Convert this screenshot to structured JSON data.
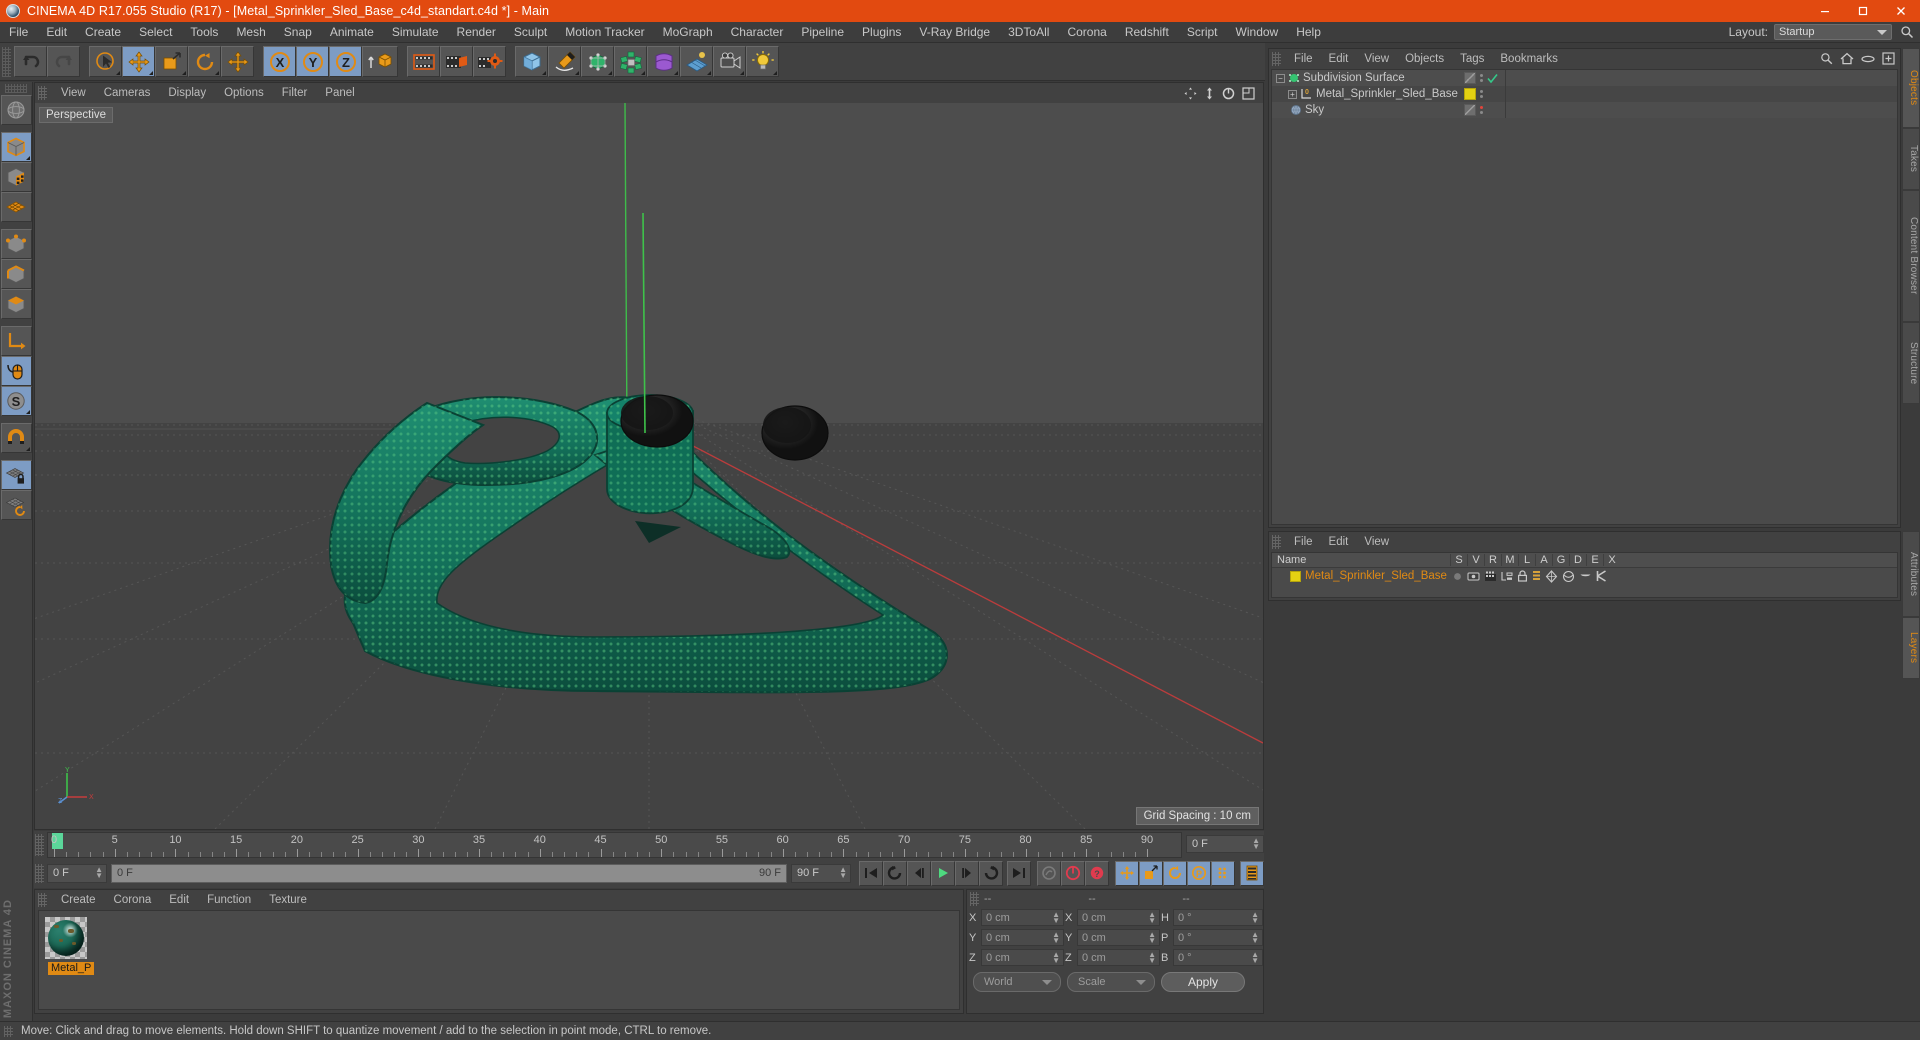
{
  "window": {
    "title": "CINEMA 4D R17.055 Studio (R17) - [Metal_Sprinkler_Sled_Base_c4d_standart.c4d *] - Main",
    "titlebar_color": "#e24a10",
    "minimize": "–",
    "maximize": "❐",
    "close": "✕"
  },
  "menubar": {
    "items": [
      {
        "label": "File"
      },
      {
        "label": "Edit"
      },
      {
        "label": "Create"
      },
      {
        "label": "Select"
      },
      {
        "label": "Tools"
      },
      {
        "label": "Mesh"
      },
      {
        "label": "Snap"
      },
      {
        "label": "Animate"
      },
      {
        "label": "Simulate"
      },
      {
        "label": "Render"
      },
      {
        "label": "Sculpt"
      },
      {
        "label": "Motion Tracker"
      },
      {
        "label": "MoGraph"
      },
      {
        "label": "Character"
      },
      {
        "label": "Pipeline"
      },
      {
        "label": "Plugins"
      },
      {
        "label": "V-Ray Bridge"
      },
      {
        "label": "3DToAll"
      },
      {
        "label": "Corona"
      },
      {
        "label": "Redshift"
      },
      {
        "label": "Script"
      },
      {
        "label": "Window"
      },
      {
        "label": "Help"
      }
    ],
    "layout_label": "Layout:",
    "layout_value": "Startup"
  },
  "toolbar": {
    "buttons": [
      {
        "name": "undo-button",
        "icon": "undo-icon",
        "active": false
      },
      {
        "name": "redo-button",
        "icon": "redo-icon",
        "active": false
      },
      {
        "name": "live-selection-button",
        "icon": "cursor-select-icon",
        "active": false
      },
      {
        "name": "move-tool-button",
        "icon": "move-icon",
        "active": true
      },
      {
        "name": "scale-tool-button",
        "icon": "scale-icon",
        "active": false
      },
      {
        "name": "rotate-tool-button",
        "icon": "rotate-icon",
        "active": false
      },
      {
        "name": "move-axis-button",
        "icon": "move-icon",
        "active": false
      },
      {
        "name": "x-axis-lock-button",
        "icon": "x-axis-icon",
        "active": true
      },
      {
        "name": "y-axis-lock-button",
        "icon": "y-axis-icon",
        "active": true
      },
      {
        "name": "z-axis-lock-button",
        "icon": "z-axis-icon",
        "active": true
      },
      {
        "name": "world-object-coordinates-button",
        "icon": "world-coordinates-icon",
        "active": false
      },
      {
        "name": "render-view-button",
        "icon": "render-frame-icon",
        "active": false
      },
      {
        "name": "render-region-button",
        "icon": "render-region-icon",
        "active": false
      },
      {
        "name": "render-settings-button",
        "icon": "render-settings-icon",
        "active": false
      },
      {
        "name": "add-cube-button",
        "icon": "cube-icon",
        "active": false
      },
      {
        "name": "add-spline-button",
        "icon": "pen-spline-icon",
        "active": false
      },
      {
        "name": "add-generator-button",
        "icon": "subdivision-surface-icon",
        "active": false
      },
      {
        "name": "add-mograph-button",
        "icon": "mograph-cloner-icon",
        "active": false
      },
      {
        "name": "add-deformer-button",
        "icon": "deformer-icon",
        "active": false
      },
      {
        "name": "add-scene-button",
        "icon": "scene-floor-icon",
        "active": false
      },
      {
        "name": "add-camera-button",
        "icon": "camera-icon",
        "active": false
      },
      {
        "name": "add-light-button",
        "icon": "light-bulb-icon",
        "active": false
      }
    ]
  },
  "left_toolbar": {
    "buttons": [
      {
        "name": "use-model-tool-button",
        "icon": "globe-axis-icon",
        "active": false
      },
      {
        "name": "model-mode-button",
        "icon": "model-cube-icon",
        "active": true
      },
      {
        "name": "texture-mode-button",
        "icon": "texture-cube-icon",
        "active": false
      },
      {
        "name": "workplane-mode-button",
        "icon": "workplane-grid-icon",
        "active": false
      },
      {
        "name": "points-mode-button",
        "icon": "points-cube-icon",
        "active": false
      },
      {
        "name": "edges-mode-button",
        "icon": "edges-cube-icon",
        "active": false
      },
      {
        "name": "polygons-mode-button",
        "icon": "polygons-cube-icon",
        "active": false
      },
      {
        "name": "object-axis-mode-button",
        "icon": "axis-corner-icon",
        "active": false
      },
      {
        "name": "viewport-solo-button",
        "icon": "mouse-icon",
        "active": true
      },
      {
        "name": "enable-snap-button",
        "icon": "snap-s-icon",
        "active": true
      },
      {
        "name": "magnet-button",
        "icon": "magnet-icon",
        "active": false
      },
      {
        "name": "workplane-lock-button",
        "icon": "grid-lock-icon",
        "active": true
      },
      {
        "name": "workplane-rotate-button",
        "icon": "grid-rotate-icon",
        "active": false
      }
    ],
    "brand_line1": "MAXON",
    "brand_line2": "CINEMA 4D"
  },
  "viewport": {
    "menu_items": [
      {
        "label": "View"
      },
      {
        "label": "Cameras"
      },
      {
        "label": "Display"
      },
      {
        "label": "Options"
      },
      {
        "label": "Filter"
      },
      {
        "label": "Panel"
      }
    ],
    "label": "Perspective",
    "grid_spacing": "Grid Spacing : 10 cm",
    "nav_icons": [
      "pan-icon",
      "dolly-icon",
      "rotate-view-icon",
      "maximize-view-icon"
    ],
    "axis_labels": {
      "x": "X",
      "y": "Y",
      "z": "Z"
    },
    "model_color": "#157a62",
    "model_dot_color": "#5fcf85",
    "background_top": "#4b4b4b",
    "background_bottom": "#3a3a3a",
    "x_axis_color": "#c83c3c",
    "y_axis_color": "#3ec24a"
  },
  "timeline": {
    "ticks": [
      {
        "label": "0",
        "value": 0
      },
      {
        "label": "5",
        "value": 5
      },
      {
        "label": "10",
        "value": 10
      },
      {
        "label": "15",
        "value": 15
      },
      {
        "label": "20",
        "value": 20
      },
      {
        "label": "25",
        "value": 25
      },
      {
        "label": "30",
        "value": 30
      },
      {
        "label": "35",
        "value": 35
      },
      {
        "label": "40",
        "value": 40
      },
      {
        "label": "45",
        "value": 45
      },
      {
        "label": "50",
        "value": 50
      },
      {
        "label": "55",
        "value": 55
      },
      {
        "label": "60",
        "value": 60
      },
      {
        "label": "65",
        "value": 65
      },
      {
        "label": "70",
        "value": 70
      },
      {
        "label": "75",
        "value": 75
      },
      {
        "label": "80",
        "value": 80
      },
      {
        "label": "85",
        "value": 85
      },
      {
        "label": "90",
        "value": 90
      }
    ],
    "range_start": 0,
    "range_end": 90,
    "current_frame_right": "0 F",
    "current_frame_field": "0 F",
    "scrub_left": "0 F",
    "scrub_right": "90 F",
    "end_frame_field": "90 F",
    "playhead_frame": 0,
    "buttons": [
      {
        "name": "go-to-start-button",
        "icon": "skip-start-icon",
        "active": false
      },
      {
        "name": "go-to-previous-key-button",
        "icon": "prev-key-icon",
        "active": false
      },
      {
        "name": "step-back-button",
        "icon": "step-back-icon",
        "active": false
      },
      {
        "name": "play-button",
        "icon": "play-icon",
        "active": false
      },
      {
        "name": "step-forward-button",
        "icon": "step-forward-icon",
        "active": false
      },
      {
        "name": "go-to-next-key-button",
        "icon": "next-key-icon",
        "active": false
      },
      {
        "name": "go-to-end-button",
        "icon": "skip-end-icon",
        "active": false
      },
      {
        "name": "record-active-objects-button",
        "icon": "record-disabled-icon",
        "active": false
      },
      {
        "name": "autokeying-button",
        "icon": "autokey-icon",
        "active": false
      },
      {
        "name": "keyframe-selection-button",
        "icon": "keyframe-help-icon",
        "active": false
      },
      {
        "name": "position-key-button",
        "icon": "move-icon",
        "active": true
      },
      {
        "name": "scale-key-button",
        "icon": "scale-icon",
        "active": true
      },
      {
        "name": "rotation-key-button",
        "icon": "rotate-icon",
        "active": true
      },
      {
        "name": "parameter-key-button",
        "icon": "parameter-p-icon",
        "active": true
      },
      {
        "name": "point-level-animation-button",
        "icon": "pla-dots-icon",
        "active": true
      },
      {
        "name": "timeline-toggle-button",
        "icon": "timeline-strip-icon",
        "active": true
      }
    ]
  },
  "material_manager": {
    "menu_items": [
      {
        "label": "Create"
      },
      {
        "label": "Corona"
      },
      {
        "label": "Edit"
      },
      {
        "label": "Function"
      },
      {
        "label": "Texture"
      }
    ],
    "materials": [
      {
        "name": "Metal_P",
        "color": "#1d6b58",
        "selected": true
      }
    ]
  },
  "coordinate_manager": {
    "headers": [
      "--",
      "--",
      "--"
    ],
    "rows": [
      {
        "pos_label": "X",
        "pos_value": "0 cm",
        "size_label": "X",
        "size_value": "0 cm",
        "rot_label": "H",
        "rot_value": "0 °"
      },
      {
        "pos_label": "Y",
        "pos_value": "0 cm",
        "size_label": "Y",
        "size_value": "0 cm",
        "rot_label": "P",
        "rot_value": "0 °"
      },
      {
        "pos_label": "Z",
        "pos_value": "0 cm",
        "size_label": "Z",
        "size_value": "0 cm",
        "rot_label": "B",
        "rot_value": "0 °"
      }
    ],
    "coord_system": "World",
    "transform_mode": "Scale",
    "apply_label": "Apply"
  },
  "object_manager": {
    "menu_items": [
      {
        "label": "File"
      },
      {
        "label": "Edit"
      },
      {
        "label": "View"
      },
      {
        "label": "Objects"
      },
      {
        "label": "Tags"
      },
      {
        "label": "Bookmarks"
      }
    ],
    "header_icons": [
      "search-icon",
      "home-icon",
      "eye-icon",
      "expand-icon"
    ],
    "rows": [
      {
        "name": "Subdivision Surface",
        "icon": "subdivision-surface-icon",
        "indent": 0,
        "expandable": true,
        "tag": "diagonal",
        "marker": "check",
        "marker_color": "#35c98a"
      },
      {
        "name": "Metal_Sprinkler_Sled_Base",
        "icon": "polygon-object-icon",
        "indent": 1,
        "expandable": true,
        "tag": "yellow",
        "marker": "none"
      },
      {
        "name": "Sky",
        "icon": "sky-sphere-icon",
        "indent": 1,
        "expandable": false,
        "tag": "diagonal",
        "marker": "dot",
        "marker_color": "#e2453c"
      }
    ]
  },
  "layer_manager": {
    "menu_items": [
      {
        "label": "File"
      },
      {
        "label": "Edit"
      },
      {
        "label": "View"
      }
    ],
    "columns": [
      "Name",
      "S",
      "V",
      "R",
      "M",
      "L",
      "A",
      "G",
      "D",
      "E",
      "X"
    ],
    "rows": [
      {
        "name": "Metal_Sprinkler_Sled_Base",
        "color": "#e4d112",
        "text_color": "#e08a14",
        "icons": [
          "solo-dot-icon",
          "visible-icon",
          "render-icon",
          "manager-icon",
          "lock-icon",
          "animation-icon",
          "generators-icon",
          "deformers-icon",
          "expressions-icon",
          "xref-icon"
        ]
      }
    ]
  },
  "right_tabs": {
    "top": [
      {
        "label": "Objects",
        "active": true
      },
      {
        "label": "Takes",
        "active": false
      },
      {
        "label": "Content Browser",
        "active": false
      },
      {
        "label": "Structure",
        "active": false
      }
    ],
    "bottom": [
      {
        "label": "Attributes",
        "active": false
      },
      {
        "label": "Layers",
        "active": true
      }
    ]
  },
  "statusbar": {
    "text": "Move: Click and drag to move elements. Hold down SHIFT to quantize movement / add to the selection in point mode, CTRL to remove."
  }
}
